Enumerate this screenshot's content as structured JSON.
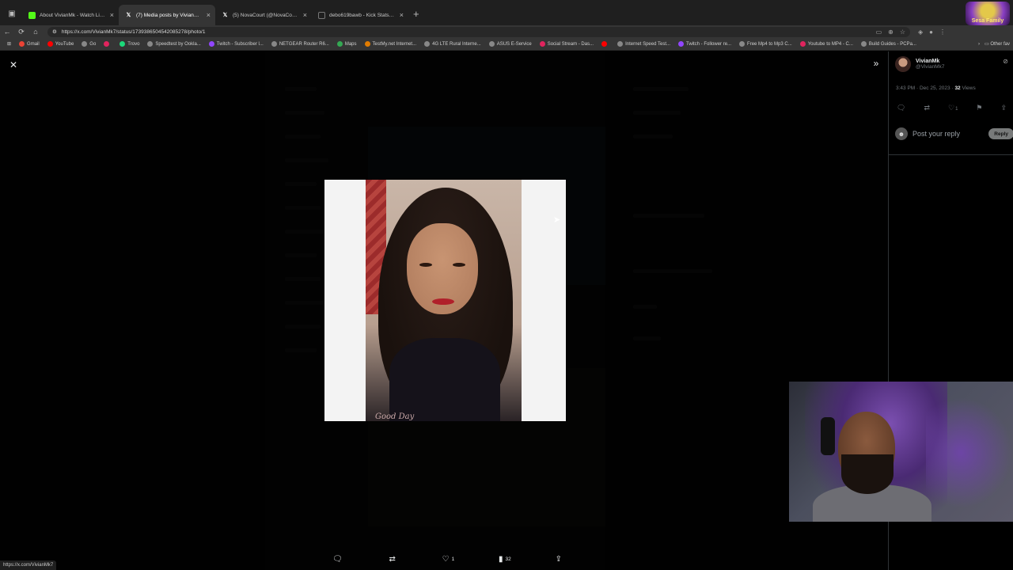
{
  "browser": {
    "tabs": [
      {
        "title": "About VivianMk - Watch Live on",
        "favicon": "kick",
        "color": "#53fc18",
        "active": false
      },
      {
        "title": "(7) Media posts by VivianMk (@V",
        "favicon": "x",
        "color": "#ffffff",
        "active": true
      },
      {
        "title": "(5) NovaCourt (@NovaCourtt) / X",
        "favicon": "x",
        "color": "#ffffff",
        "active": false
      },
      {
        "title": "debo619bawb - Kick Stats, Analy",
        "favicon": "stats",
        "color": "#777777",
        "active": false
      }
    ],
    "close_glyph": "×",
    "new_tab_glyph": "+",
    "url": "https://x.com/VivianMk7/status/1739386504542085278/photo/1",
    "bookmarks": [
      {
        "label": "Gmail",
        "color": "#ea4335"
      },
      {
        "label": "YouTube",
        "color": "#ff0000"
      },
      {
        "label": "Go",
        "color": "#888888"
      },
      {
        "label": "",
        "color": "#e0245e"
      },
      {
        "label": "Trovo",
        "color": "#1cd97a"
      },
      {
        "label": "Speedtest by Ookla...",
        "color": "#888888"
      },
      {
        "label": "Twitch - Subscriber l...",
        "color": "#9146ff"
      },
      {
        "label": "NETGEAR Router R6...",
        "color": "#888888"
      },
      {
        "label": "Maps",
        "color": "#34a853"
      },
      {
        "label": "TestMy.net Internet...",
        "color": "#e07b00"
      },
      {
        "label": "4G LTE Rural Interne...",
        "color": "#888888"
      },
      {
        "label": "ASUS E-Service",
        "color": "#888888"
      },
      {
        "label": "Social Stream - Das...",
        "color": "#e0245e"
      },
      {
        "label": "",
        "color": "#ff0000"
      },
      {
        "label": "Internet Speed Test...",
        "color": "#888888"
      },
      {
        "label": "Twitch - Follower re...",
        "color": "#9146ff"
      },
      {
        "label": "Free Mp4 to Mp3 C...",
        "color": "#888888"
      },
      {
        "label": "Youtube to MP4 - C...",
        "color": "#e0245e"
      },
      {
        "label": "Build Guides - PCPa...",
        "color": "#888888"
      }
    ],
    "other_bookmarks": "Other fav",
    "status_url": "https://x.com/VivianMk7",
    "stream_logo_text": "Sesa Family"
  },
  "viewer": {
    "photo_caption": "Good Day",
    "actions": {
      "reply_count": "",
      "repost_count": "",
      "like_count": "1",
      "views_count": "32"
    }
  },
  "side": {
    "display_name": "VivianMk",
    "handle": "@VivianMk7",
    "time": "3:43 PM · Dec 25, 2023 ·",
    "views_number": "32",
    "views_label": "Views",
    "like_count": "1",
    "reply_placeholder": "Post your reply",
    "reply_button": "Reply"
  }
}
